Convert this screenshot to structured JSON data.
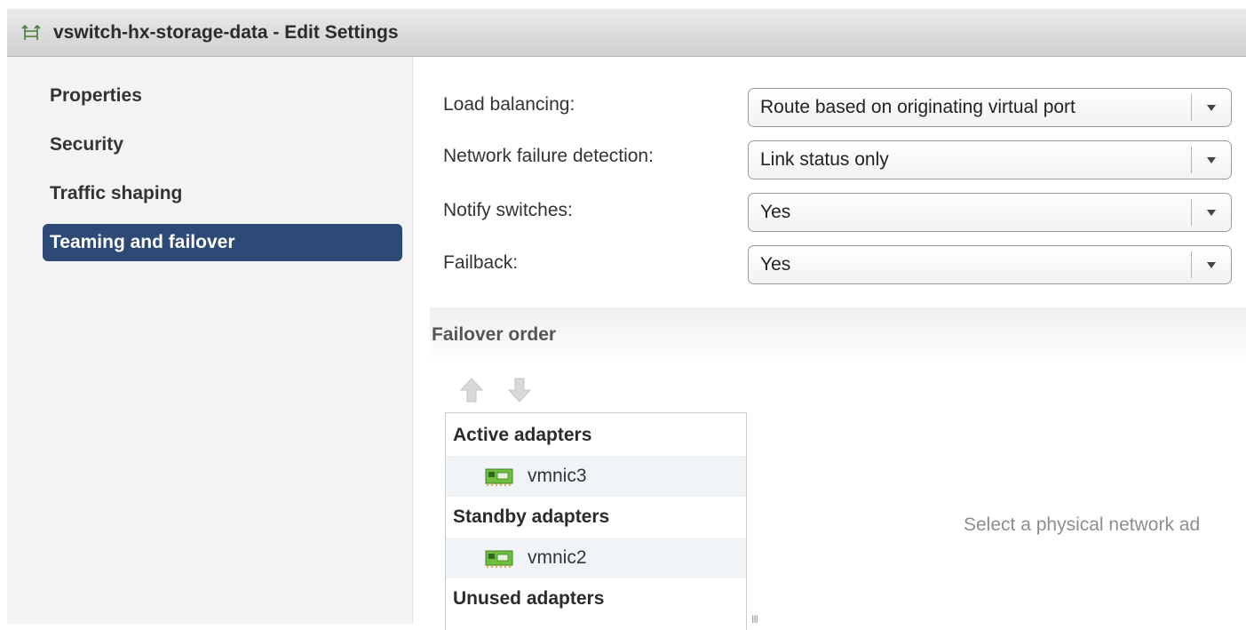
{
  "window": {
    "title": "vswitch-hx-storage-data - Edit Settings",
    "icon": "vswitch-icon"
  },
  "sidebar": {
    "items": [
      {
        "label": "Properties",
        "selected": false
      },
      {
        "label": "Security",
        "selected": false
      },
      {
        "label": "Traffic shaping",
        "selected": false
      },
      {
        "label": "Teaming and failover",
        "selected": true
      }
    ],
    "selected_color": "#2d4a77"
  },
  "form": {
    "load_balancing": {
      "label": "Load balancing:",
      "value": "Route based on originating virtual port"
    },
    "network_failure_detection": {
      "label": "Network failure detection:",
      "value": "Link status only"
    },
    "notify_switches": {
      "label": "Notify switches:",
      "value": "Yes"
    },
    "failback": {
      "label": "Failback:",
      "value": "Yes"
    }
  },
  "failover": {
    "title": "Failover order",
    "move_up_icon": "arrow-up-icon",
    "move_down_icon": "arrow-down-icon",
    "groups": [
      {
        "label": "Active adapters",
        "adapters": [
          "vmnic3"
        ]
      },
      {
        "label": "Standby adapters",
        "adapters": [
          "vmnic2"
        ]
      },
      {
        "label": "Unused adapters",
        "adapters": []
      }
    ],
    "hint": "Select a physical network ad",
    "grip": "III"
  }
}
